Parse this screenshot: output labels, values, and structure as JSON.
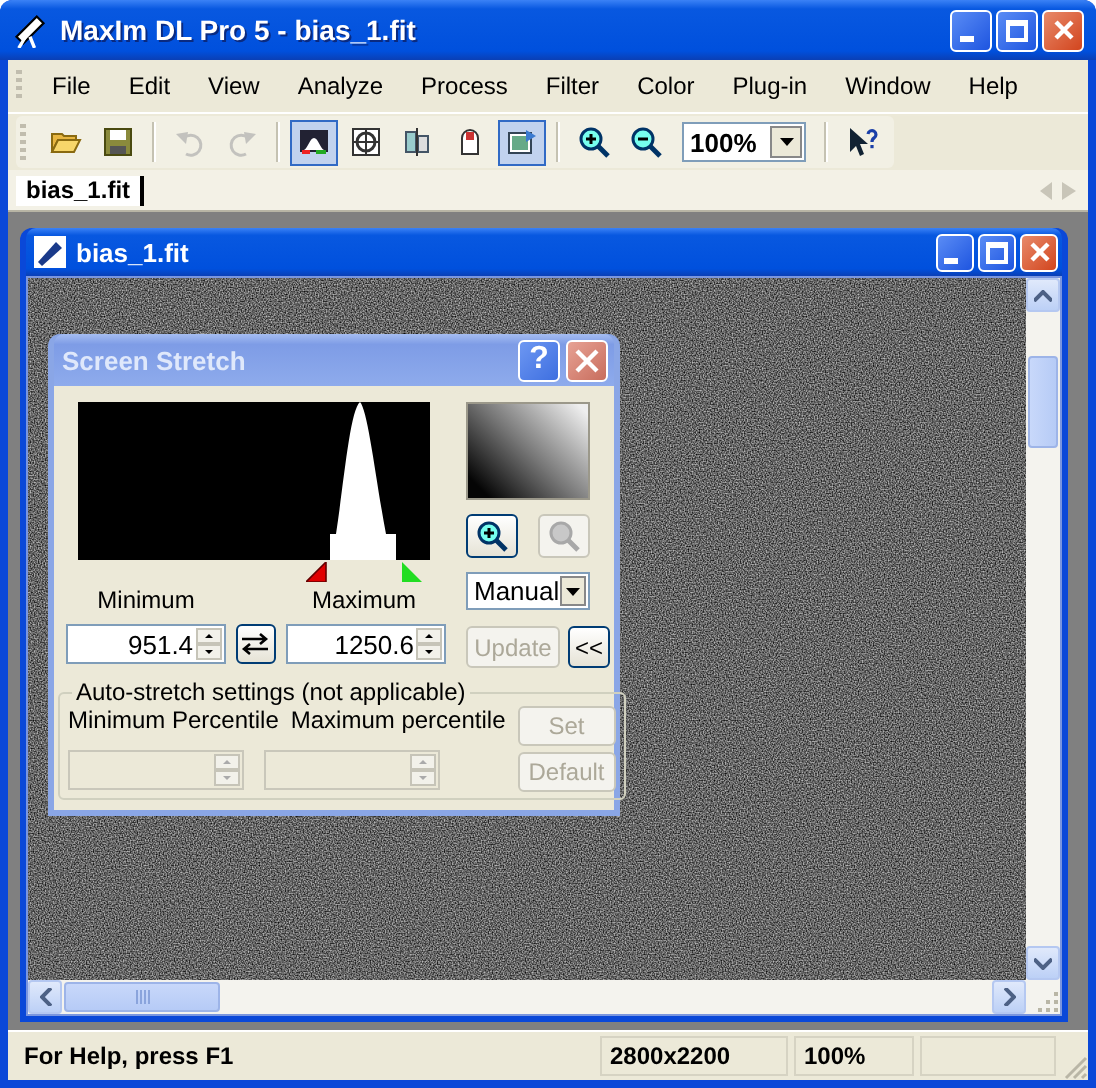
{
  "window": {
    "title": "MaxIm DL Pro 5 - bias_1.fit"
  },
  "menu": [
    "File",
    "Edit",
    "View",
    "Analyze",
    "Process",
    "Filter",
    "Color",
    "Plug-in",
    "Window",
    "Help"
  ],
  "toolbar": [
    {
      "kind": "button",
      "selected": false,
      "disabled": false
    },
    {
      "kind": "button",
      "selected": false,
      "disabled": false
    },
    {
      "kind": "separator"
    },
    {
      "kind": "button",
      "selected": false,
      "disabled": true
    },
    {
      "kind": "button",
      "selected": false,
      "disabled": true
    },
    {
      "kind": "separator"
    },
    {
      "kind": "button",
      "selected": true,
      "disabled": false
    },
    {
      "kind": "button",
      "selected": false,
      "disabled": false
    },
    {
      "kind": "button",
      "selected": false,
      "disabled": false
    },
    {
      "kind": "button",
      "selected": false,
      "disabled": false
    },
    {
      "kind": "button",
      "selected": true,
      "disabled": false
    },
    {
      "kind": "separator"
    },
    {
      "kind": "button",
      "selected": false,
      "disabled": false
    },
    {
      "kind": "button",
      "selected": false,
      "disabled": false
    },
    {
      "kind": "combo",
      "value": "100%"
    },
    {
      "kind": "separator"
    },
    {
      "kind": "button",
      "selected": false,
      "disabled": false
    }
  ],
  "document_tabs": [
    {
      "label": "bias_1.fit",
      "selected": true
    }
  ],
  "child_window": {
    "title": "bias_1.fit"
  },
  "dialog": {
    "title": "Screen Stretch",
    "help_button": "?",
    "minimum_label": "Minimum",
    "maximum_label": "Maximum",
    "minimum": "951.4",
    "maximum": "1250.6",
    "mode": "Manual",
    "zoom_in_disabled": false,
    "zoom_out_disabled": true,
    "update_button": {
      "label": "Update",
      "disabled": true
    },
    "collapse_button": "<<",
    "group": {
      "title": "Auto-stretch settings (not applicable)",
      "minimum_label": "Minimum Percentile",
      "maximum_label": "Maximum percentile",
      "fields_disabled": true,
      "set_button": {
        "label": "Set",
        "disabled": true
      },
      "default_button": {
        "label": "Default",
        "disabled": true
      }
    }
  },
  "status_bar": [
    "For Help, press F1",
    "2800x2200",
    "100%"
  ]
}
